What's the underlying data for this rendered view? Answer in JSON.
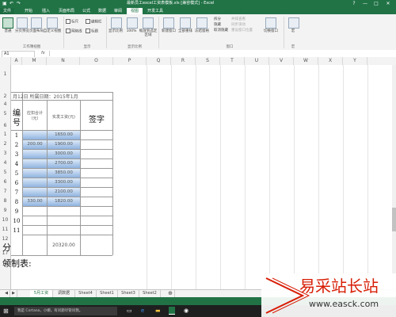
{
  "title_bar": {
    "title": "最新员工excel工资表模板.xls [兼容模式] - Excel",
    "icons": [
      "save-icon",
      "undo-icon",
      "redo-icon"
    ],
    "controls": [
      "?",
      "—",
      "□",
      "✕"
    ]
  },
  "tabs": [
    "文件",
    "开始",
    "插入",
    "页面布局",
    "公式",
    "数据",
    "审阅",
    "视图",
    "开发工具"
  ],
  "ribbon": {
    "views": [
      "普通",
      "分页预览",
      "页面布局",
      "自定义视图"
    ],
    "views_group": "工作簿视图",
    "show": {
      "ruler": "标尺",
      "formula_bar": "编辑栏",
      "gridlines": "网格线",
      "headings": "标题"
    },
    "show_group": "显示",
    "zoom": [
      "显示比例",
      "100%",
      "缩放到选定区域"
    ],
    "zoom_group": "显示比例",
    "window": [
      "新建窗口",
      "全部重排",
      "冻结窗格",
      "拆分",
      "隐藏",
      "取消隐藏",
      "并排查看",
      "同步滚动",
      "重设窗口位置",
      "切换窗口"
    ],
    "window_group": "窗口",
    "macro": "宏",
    "macro_group": "宏"
  },
  "formula_bar": {
    "name_box": "A1",
    "fx": "fx",
    "value": ""
  },
  "column_headers": [
    "A",
    "M",
    "N",
    "O",
    "P",
    "Q",
    "R",
    "S",
    "T",
    "U",
    "V",
    "W",
    "X",
    "Y"
  ],
  "row_numbers": [
    "1",
    "2",
    "4",
    "5",
    "6",
    "1",
    "2",
    "3",
    "4",
    "5",
    "6",
    "7",
    "8",
    "9",
    "10",
    "11",
    "12",
    "17",
    "18"
  ],
  "sheet": {
    "header_text": "月12日  所属日期：2015年1月",
    "col_bianhao": "编号",
    "col_deduct": "应扣合计（元）",
    "col_actual": "实发工资(元)",
    "col_sign": "签字",
    "row_nums": [
      "1",
      "2",
      "3",
      "4",
      "5",
      "6",
      "7",
      "8",
      "9",
      "10",
      "11"
    ],
    "deduct_values": [
      "",
      "200.00",
      "",
      "",
      "",
      "",
      "",
      "330.00",
      "",
      "",
      ""
    ],
    "actual_values": [
      "1650.00",
      "1900.00",
      "3000.00",
      "2700.00",
      "3850.00",
      "3300.00",
      "2100.00",
      "1820.00",
      "",
      "",
      ""
    ],
    "total_label": "分",
    "total_value": "20320.00",
    "footer_label": "领制表:"
  },
  "sheet_tabs": [
    "5月工资",
    "调数据",
    "Sheet4",
    "Sheet1",
    "Sheet3",
    "Sheet2"
  ],
  "taskbar": {
    "search": "我是 Cortana，小娜。有问题尽管问我。"
  },
  "watermark": {
    "text": "易采站长站",
    "url": "www.easck.com"
  },
  "colors": {
    "excel_green": "#217346",
    "watermark_red": "#d81e06"
  }
}
